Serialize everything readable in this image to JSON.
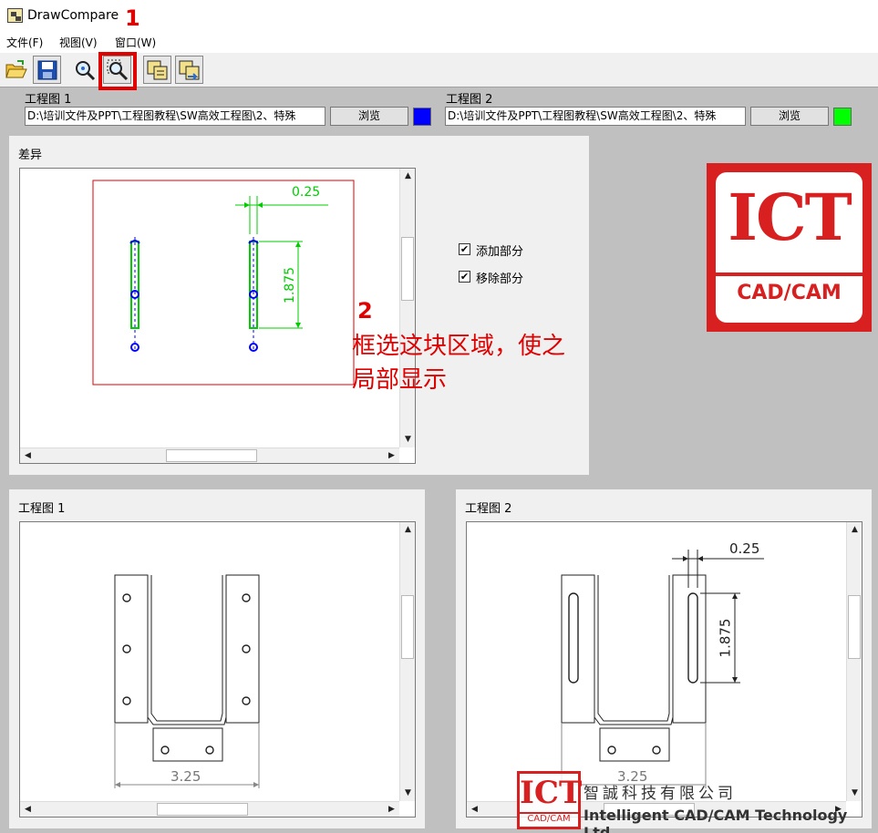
{
  "window": {
    "title": "DrawCompare"
  },
  "menu": {
    "file": "文件(F)",
    "view": "视图(V)",
    "window": "窗口(W)"
  },
  "toolbar": {
    "buttons": [
      {
        "icon": "open-folder-icon"
      },
      {
        "icon": "save-disk-icon"
      },
      {
        "icon": "zoom-icon"
      },
      {
        "icon": "zoom-window-icon"
      },
      {
        "icon": "compare-icon"
      },
      {
        "icon": "swap-compare-icon"
      }
    ]
  },
  "annotations": {
    "step1": "1",
    "step2": "2",
    "note_line1": "框选这块区域，使之",
    "note_line2": "局部显示",
    "highlight_color": "#e00000"
  },
  "drawing1": {
    "label": "工程图 1",
    "path": "D:\\培训文件及PPT\\工程图教程\\SW高效工程图\\2、特殊",
    "browse": "浏览",
    "color": "#0000ff"
  },
  "drawing2": {
    "label": "工程图 2",
    "path": "D:\\培训文件及PPT\\工程图教程\\SW高效工程图\\2、特殊",
    "browse": "浏览",
    "color": "#00ff00"
  },
  "diff_panel": {
    "title": "差异",
    "dim_width": "0.25",
    "dim_height": "1.875",
    "added_label": "添加部分",
    "added_checked": true,
    "removed_label": "移除部分",
    "removed_checked": true
  },
  "view1": {
    "title": "工程图 1",
    "dim_width": "3.25"
  },
  "view2": {
    "title": "工程图 2",
    "dim_width": "3.25",
    "dim_slot": "0.25",
    "dim_height": "1.875"
  },
  "logo": {
    "big": "ICT",
    "small": "CAD/CAM"
  },
  "watermark": {
    "logo_big": "ICT",
    "logo_small": "CAD/CAM",
    "company_cn": "智誠科技有限公司",
    "company_en": "Intelligent CAD/CAM Technology Ltd."
  }
}
